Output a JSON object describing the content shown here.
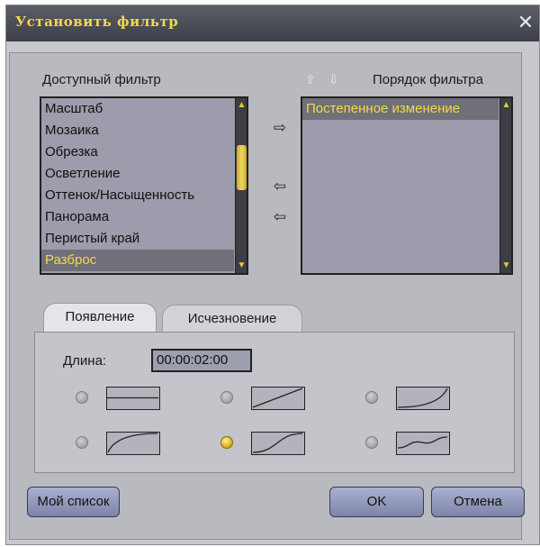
{
  "window": {
    "title": "Установить фильтр",
    "close_glyph": "✕"
  },
  "available": {
    "label": "Доступный фильтр",
    "items": [
      "Масштаб",
      "Мозаика",
      "Обрезка",
      "Осветление",
      "Оттенок/Насыщенность",
      "Панорама",
      "Перистый край",
      "Разброс"
    ],
    "selected_index": 7
  },
  "order": {
    "label": "Порядок фильтра",
    "items": [
      "Постепенное изменение"
    ],
    "up_glyph": "⇧",
    "down_glyph": "⇩"
  },
  "move_buttons": {
    "add": "⇨",
    "remove": "⇦",
    "remove_all": "⇦"
  },
  "tabs": [
    {
      "label": "Появление"
    },
    {
      "label": "Исчезновение"
    }
  ],
  "duration": {
    "label": "Длина:",
    "value": "00:00:02:00"
  },
  "curves": {
    "selected_index": 4
  },
  "buttons": {
    "my_list": "Мой список",
    "ok": "OK",
    "cancel": "Отмена"
  },
  "colors": {
    "accent": "#f5d84a",
    "title_bg": "#4a4c56",
    "list_bg": "#9c9cac",
    "button": "#8f96bc"
  }
}
